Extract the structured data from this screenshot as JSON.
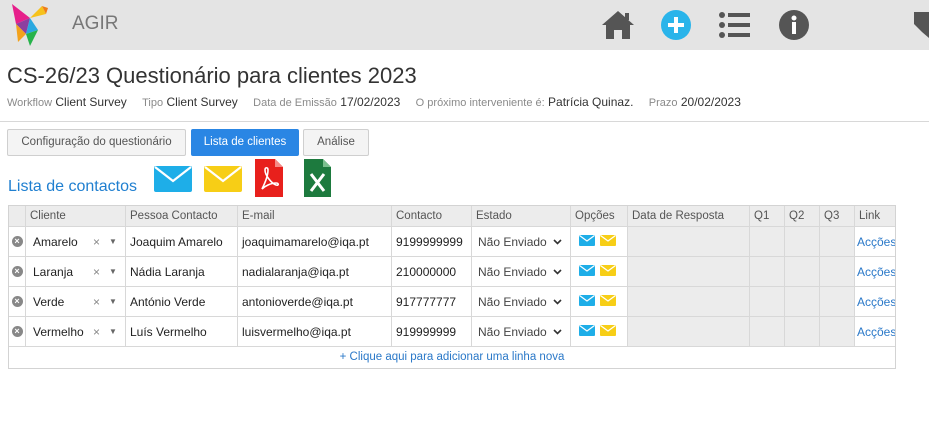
{
  "app": {
    "name": "AGIR"
  },
  "topbar_icons": [
    "home-icon",
    "add-circle-icon",
    "list-icon",
    "info-icon",
    "tag-icon"
  ],
  "page": {
    "title": "CS-26/23 Questionário para clientes 2023",
    "meta": [
      {
        "label": "Workflow",
        "value": "Client Survey"
      },
      {
        "label": "Tipo",
        "value": "Client Survey"
      },
      {
        "label": "Data de Emissão",
        "value": "17/02/2023"
      },
      {
        "label": "O próximo interveniente é:",
        "value": "Patrícia Quinaz."
      },
      {
        "label": "Prazo",
        "value": "20/02/2023"
      }
    ]
  },
  "tabs": [
    {
      "label": "Configuração do questionário",
      "active": false
    },
    {
      "label": "Lista de clientes",
      "active": true
    },
    {
      "label": "Análise",
      "active": false
    }
  ],
  "section": {
    "title": "Lista de contactos",
    "tools": [
      "email-blue-icon",
      "email-yellow-icon",
      "pdf-icon",
      "excel-icon"
    ]
  },
  "table": {
    "columns": [
      "",
      "Cliente",
      "Pessoa Contacto",
      "E-mail",
      "Contacto",
      "Estado",
      "Opções",
      "Data de Resposta",
      "Q1",
      "Q2",
      "Q3",
      "Link"
    ],
    "rows": [
      {
        "cliente": "Amarelo",
        "pessoa": "Joaquim Amarelo",
        "email": "joaquimamarelo@iqa.pt",
        "contacto": "9199999999",
        "estado": "Não Enviado",
        "data": "",
        "q1": "",
        "q2": "",
        "q3": "",
        "link": "Acções"
      },
      {
        "cliente": "Laranja",
        "pessoa": "Nádia Laranja",
        "email": "nadialaranja@iqa.pt",
        "contacto": "210000000",
        "estado": "Não Enviado",
        "data": "",
        "q1": "",
        "q2": "",
        "q3": "",
        "link": "Acções"
      },
      {
        "cliente": "Verde",
        "pessoa": "António Verde",
        "email": "antonioverde@iqa.pt",
        "contacto": "917777777",
        "estado": "Não Enviado",
        "data": "",
        "q1": "",
        "q2": "",
        "q3": "",
        "link": "Acções"
      },
      {
        "cliente": "Vermelho",
        "pessoa": "Luís Vermelho",
        "email": "luisvermelho@iqa.pt",
        "contacto": "919999999",
        "estado": "Não Enviado",
        "data": "",
        "q1": "",
        "q2": "",
        "q3": "",
        "link": "Acções"
      }
    ],
    "add_row_label": "+ Clique aqui para adicionar uma linha nova"
  },
  "colors": {
    "accent": "#2a86e4",
    "email_blue": "#1eaee8",
    "email_yellow": "#f7ce16",
    "pdf_red": "#e8201c",
    "excel_green": "#1d7a3e"
  }
}
